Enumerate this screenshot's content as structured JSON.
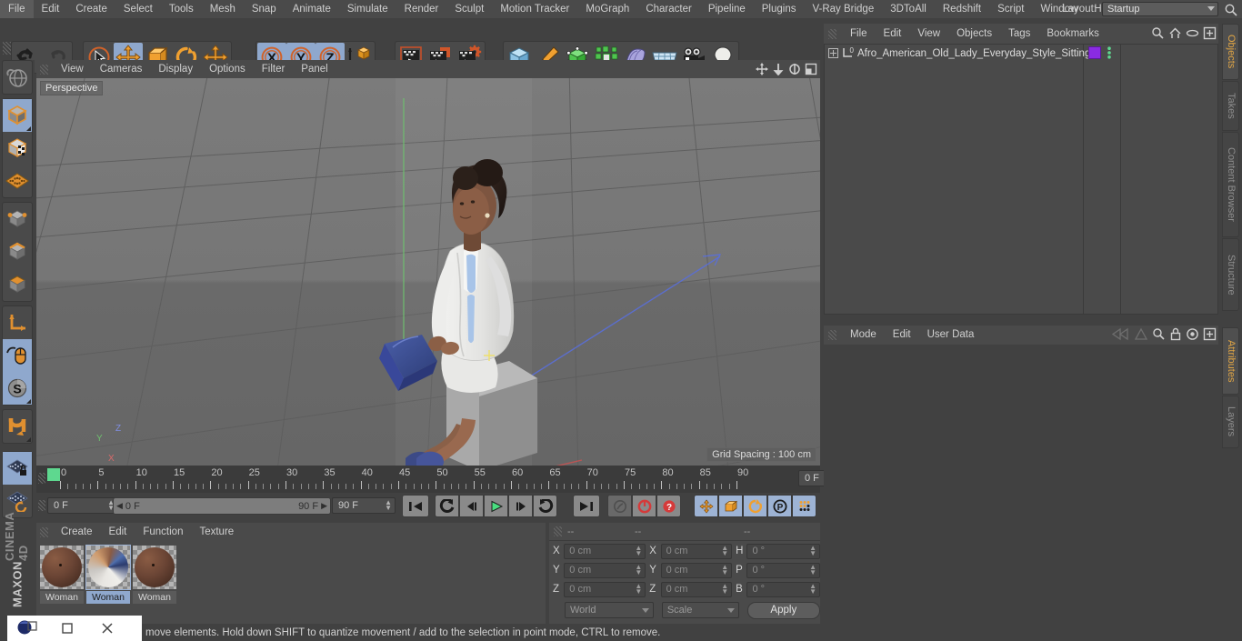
{
  "app": {
    "brand_line1": "MAXON",
    "brand_line2": "CINEMA 4D"
  },
  "menubar": {
    "items": [
      "File",
      "Edit",
      "Create",
      "Select",
      "Tools",
      "Mesh",
      "Snap",
      "Animate",
      "Simulate",
      "Render",
      "Sculpt",
      "Motion Tracker",
      "MoGraph",
      "Character",
      "Pipeline",
      "Plugins",
      "V-Ray Bridge",
      "3DToAll",
      "Redshift",
      "Script",
      "Window",
      "Help"
    ],
    "layout_label": "Layout:",
    "layout_value": "Startup",
    "search_icon": "search-icon"
  },
  "toolbar": {
    "groups": [
      {
        "name": "undo-redo",
        "buttons": [
          {
            "icon": "undo-icon",
            "selected": false
          },
          {
            "icon": "redo-icon",
            "selected": false
          }
        ]
      },
      {
        "name": "transform-tools",
        "buttons": [
          {
            "icon": "select-cursor-icon",
            "selected": false
          },
          {
            "icon": "move-icon",
            "selected": true
          },
          {
            "icon": "scale-icon",
            "selected": false
          },
          {
            "icon": "rotate-icon",
            "selected": false
          },
          {
            "icon": "move-alt-icon",
            "selected": false
          }
        ]
      },
      {
        "name": "axis-locks",
        "buttons": [
          {
            "icon": "axis-x-icon",
            "selected": true
          },
          {
            "icon": "axis-y-icon",
            "selected": true
          },
          {
            "icon": "axis-z-icon",
            "selected": true
          },
          {
            "icon": "world-object-axis-icon",
            "selected": false
          }
        ]
      },
      {
        "name": "render-tools",
        "buttons": [
          {
            "icon": "render-view-icon",
            "selected": false
          },
          {
            "icon": "render-picture-viewer-icon",
            "selected": false
          },
          {
            "icon": "render-settings-icon",
            "selected": false
          }
        ]
      },
      {
        "name": "create-objects",
        "buttons": [
          {
            "icon": "cube-primitive-icon",
            "selected": false
          },
          {
            "icon": "pen-spline-icon",
            "selected": false
          },
          {
            "icon": "nurbs-generator-icon",
            "selected": false
          },
          {
            "icon": "array-modeling-icon",
            "selected": false
          },
          {
            "icon": "deformer-icon",
            "selected": false
          },
          {
            "icon": "scene-environment-icon",
            "selected": false
          },
          {
            "icon": "camera-icon",
            "selected": false
          },
          {
            "icon": "light-icon",
            "selected": false
          }
        ]
      }
    ]
  },
  "left_palette": {
    "groups": [
      {
        "name": "viewport-nav",
        "buttons": [
          {
            "icon": "undo-view-globe-icon",
            "selected": false
          }
        ]
      },
      {
        "name": "edit-modes",
        "buttons": [
          {
            "icon": "model-mode-icon",
            "selected": true
          },
          {
            "icon": "texture-mode-icon",
            "selected": false
          },
          {
            "icon": "workplane-mode-icon",
            "selected": false
          }
        ]
      },
      {
        "name": "component-modes",
        "buttons": [
          {
            "icon": "point-mode-icon",
            "selected": false
          },
          {
            "icon": "edge-mode-icon",
            "selected": false
          },
          {
            "icon": "polygon-mode-icon",
            "selected": false
          }
        ]
      },
      {
        "name": "axis-modes",
        "buttons": [
          {
            "icon": "object-axis-icon",
            "selected": false
          },
          {
            "icon": "viewport-solo-icon",
            "selected": true
          },
          {
            "icon": "enable-axis-icon",
            "selected": true
          }
        ]
      },
      {
        "name": "magnet-group",
        "buttons": [
          {
            "icon": "magnet-icon",
            "selected": false
          }
        ]
      },
      {
        "name": "workplane-group",
        "buttons": [
          {
            "icon": "workplane-lock-icon",
            "selected": true
          },
          {
            "icon": "workplane-rotate-icon",
            "selected": false
          }
        ]
      }
    ]
  },
  "viewport": {
    "menu": [
      "View",
      "Cameras",
      "Display",
      "Options",
      "Filter",
      "Panel"
    ],
    "icons": [
      "pan-view-icon",
      "zoom-view-icon",
      "rotate-view-icon",
      "maximize-view-icon"
    ],
    "label": "Perspective",
    "grid_spacing": "Grid Spacing : 100 cm",
    "axis_gizmo": {
      "y": "Y",
      "z": "Z",
      "x": "X"
    },
    "scene_description": "Afro-American old lady in white jacket and blue tie sitting on a grey cube holding a blue bag"
  },
  "timeline": {
    "ticks": [
      0,
      5,
      10,
      15,
      20,
      25,
      30,
      35,
      40,
      45,
      50,
      55,
      60,
      65,
      70,
      75,
      80,
      85,
      90
    ],
    "current_frame_marker": 0,
    "frame_field": "0 F"
  },
  "transport": {
    "current_frame": "0 F",
    "range_start": "0 F",
    "range_end": "90 F",
    "end_frame": "90 F",
    "buttons": [
      {
        "icon": "go-to-start-icon",
        "active": false
      },
      {
        "icon": "step-back-keyframe-icon",
        "active": false
      },
      {
        "icon": "step-back-frame-icon",
        "active": false
      },
      {
        "icon": "play-icon",
        "active": false
      },
      {
        "icon": "step-forward-frame-icon",
        "active": false
      },
      {
        "icon": "step-forward-keyframe-icon",
        "active": false
      },
      {
        "icon": "go-to-end-icon",
        "active": false
      },
      {
        "icon": "record-keyframe-tools-icon",
        "active": false
      },
      {
        "icon": "autokeying-icon",
        "active": false
      },
      {
        "icon": "keyframe-help-icon",
        "active": false
      },
      {
        "icon": "key-position-icon",
        "active": true
      },
      {
        "icon": "key-scale-icon",
        "active": true
      },
      {
        "icon": "key-rotation-icon",
        "active": true
      },
      {
        "icon": "key-parameter-icon",
        "active": true
      },
      {
        "icon": "key-pla-icon",
        "active": true
      },
      {
        "icon": "timeline-filmstrip-icon",
        "active": true
      }
    ]
  },
  "material_manager": {
    "menu": [
      "Create",
      "Edit",
      "Function",
      "Texture"
    ],
    "materials": [
      {
        "name": "Woman",
        "color": "#6b4535",
        "selected": false
      },
      {
        "name": "Woman",
        "color": "#d9d6d2",
        "selected": true
      },
      {
        "name": "Woman",
        "color": "#6b4535",
        "selected": false
      }
    ]
  },
  "coordinate_manager": {
    "headers": [
      "--",
      "--",
      "--"
    ],
    "rows": [
      {
        "label_pos": "X",
        "value_pos": "0 cm",
        "label_size": "X",
        "value_size": "0 cm",
        "label_rot": "H",
        "value_rot": "0 °"
      },
      {
        "label_pos": "Y",
        "value_pos": "0 cm",
        "label_size": "Y",
        "value_size": "0 cm",
        "label_rot": "P",
        "value_rot": "0 °"
      },
      {
        "label_pos": "Z",
        "value_pos": "0 cm",
        "label_size": "Z",
        "value_size": "0 cm",
        "label_rot": "B",
        "value_rot": "0 °"
      }
    ],
    "coord_system": "World",
    "size_mode": "Scale",
    "apply_label": "Apply"
  },
  "object_manager": {
    "menu": [
      "File",
      "Edit",
      "View",
      "Objects",
      "Tags",
      "Bookmarks"
    ],
    "icons": [
      "search-icon",
      "home-icon",
      "eye-icon",
      "new-layer-icon"
    ],
    "rows": [
      {
        "name": "Afro_American_Old_Lady_Everyday_Style_Sitting",
        "object_icon": "null-object-icon",
        "expandable": true,
        "tag_color": "#8a2be2",
        "tag_dots_color": "#5ed88f"
      }
    ]
  },
  "attributes_manager": {
    "menu": [
      "Mode",
      "Edit",
      "User Data"
    ],
    "icons": [
      "nav-back-icon",
      "nav-up-icon",
      "search-icon",
      "lock-icon",
      "pin-icon",
      "new-tab-icon"
    ],
    "content": ""
  },
  "dock_tabs": {
    "top": [
      {
        "label": "Objects",
        "active": true
      },
      {
        "label": "Takes",
        "active": false
      },
      {
        "label": "Content Browser",
        "active": false
      },
      {
        "label": "Structure",
        "active": false
      }
    ],
    "bottom": [
      {
        "label": "Attributes",
        "active": true
      },
      {
        "label": "Layers",
        "active": false
      }
    ]
  },
  "status_bar": {
    "message": "move elements. Hold down SHIFT to quantize movement / add to the selection in point mode, CTRL to remove."
  },
  "taskbar": {
    "items": [
      "app-window-icon",
      "restore-window-icon",
      "close-window-icon"
    ]
  }
}
